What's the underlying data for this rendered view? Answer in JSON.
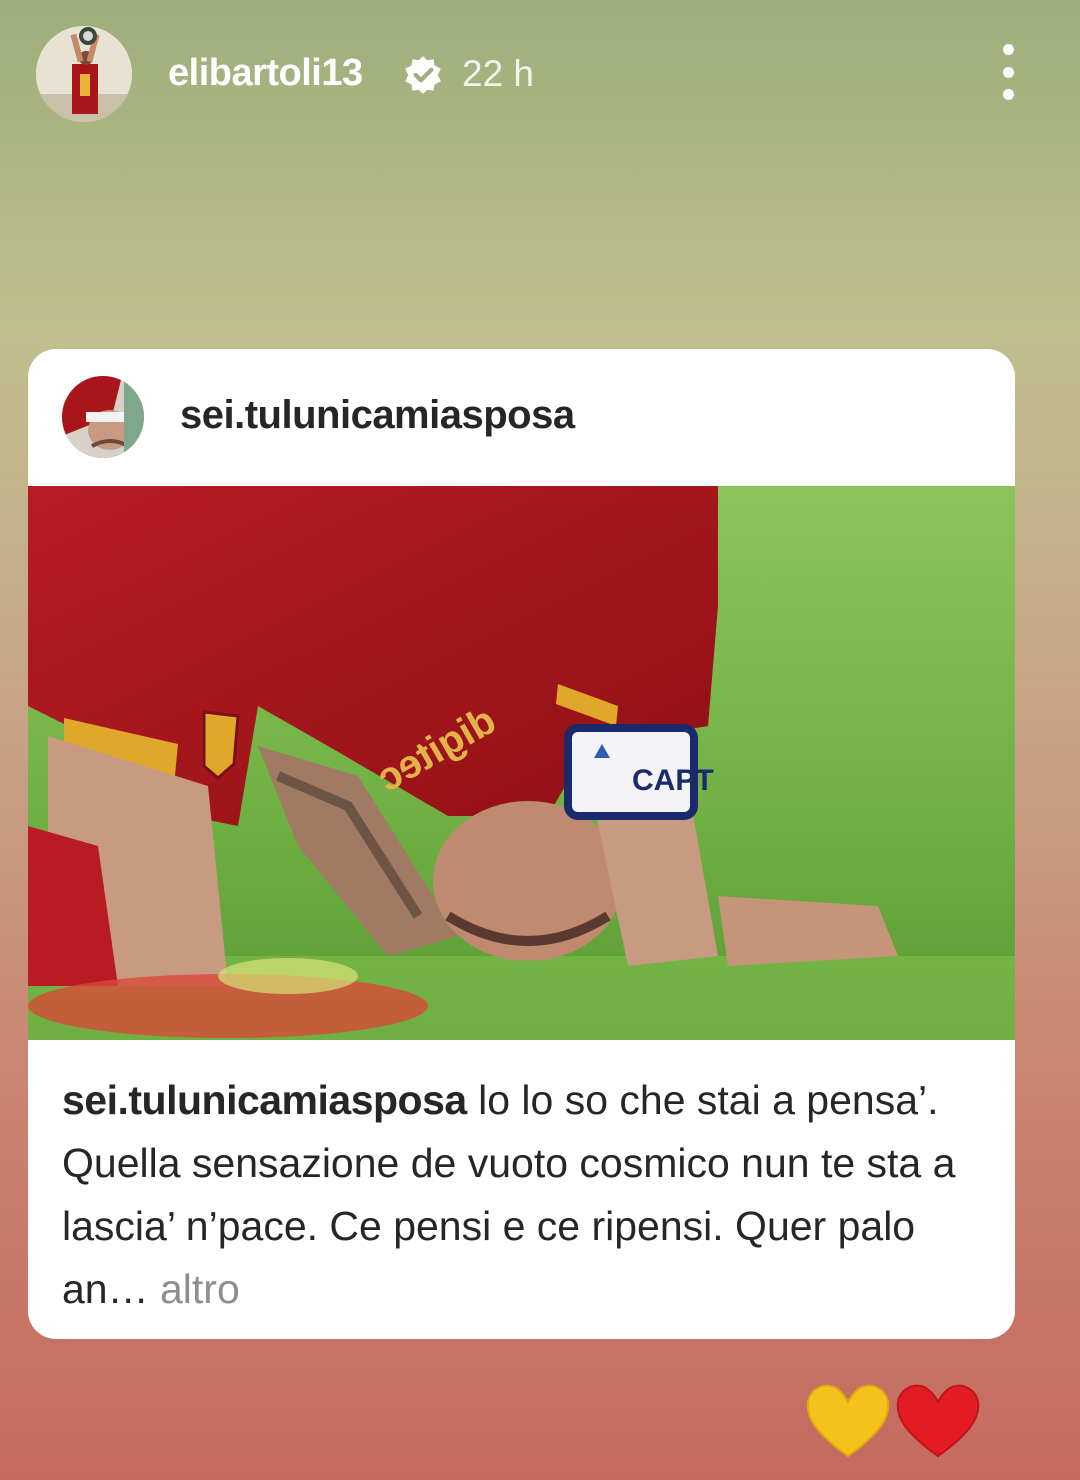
{
  "story": {
    "username": "elibartoli13",
    "verified_icon": "verified-badge-icon",
    "time": "22 h",
    "more_icon": "more-options-icon"
  },
  "card": {
    "username": "sei.tulunicamiasposa",
    "caption_username": "sei.tulunicamiasposa",
    "caption_text": " lo lo so che stai a pensa’. Quella sensazione de vuoto cosmico nun te sta a lascia’ n’pace. Ce pensi e ce ripensi. Quer palo an…",
    "more_link": " altro",
    "photo_labels": {
      "armband": "CAPT",
      "sponsor": "digitec"
    }
  },
  "reactions": [
    "yellow-heart-icon",
    "red-heart-icon"
  ],
  "colors": {
    "background_top": "#9cae7a",
    "background_bottom": "#c56a60",
    "jersey_red": "#a8161c",
    "grass_green": "#7fbd4c",
    "text_dark": "#262626",
    "text_muted": "#8e8e8e"
  }
}
